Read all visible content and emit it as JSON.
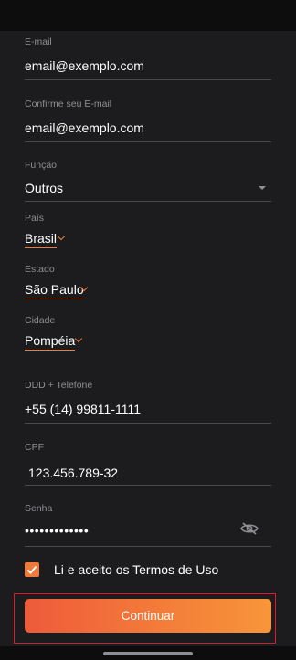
{
  "form": {
    "email": {
      "label": "E-mail",
      "value": "email@exemplo.com"
    },
    "email_confirm": {
      "label": "Confirme seu E-mail",
      "value": "email@exemplo.com"
    },
    "funcao": {
      "label": "Função",
      "value": "Outros",
      "icon": "caret-down-icon"
    },
    "pais": {
      "label": "País",
      "value": "Brasil",
      "icon": "chevron-down-icon"
    },
    "estado": {
      "label": "Estado",
      "value": "São Paulo",
      "icon": "chevron-down-icon"
    },
    "cidade": {
      "label": "Cidade",
      "value": "Pompéia",
      "icon": "chevron-down-icon"
    },
    "telefone": {
      "label": "DDD + Telefone",
      "value": "+55 (14) 99811-1111"
    },
    "cpf": {
      "label": "CPF",
      "value": "123.456.789-32"
    },
    "senha": {
      "label": "Senha",
      "value": "•••••••••••••",
      "icon": "eye-off-icon"
    }
  },
  "terms": {
    "label": "Li e aceito os Termos de Uso",
    "checked": true
  },
  "submit": {
    "label": "Continuar"
  },
  "colors": {
    "accent": "#f07a3a",
    "background": "#1c1c1e",
    "highlight_border": "#e0182d"
  }
}
